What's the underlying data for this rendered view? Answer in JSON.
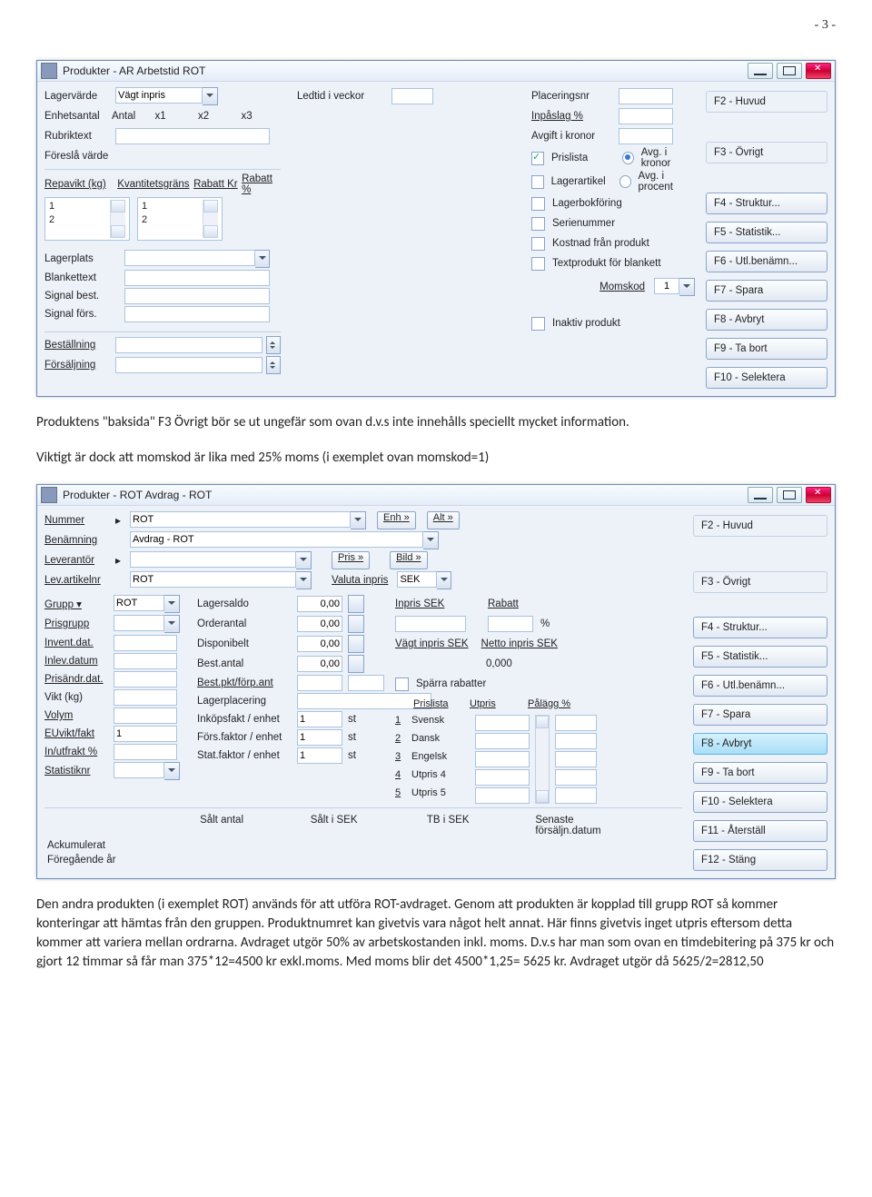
{
  "page_number": "- 3 -",
  "doc": {
    "p1": "Produktens \"baksida\" F3 Övrigt bör se ut ungefär som ovan d.v.s  inte innehålls speciellt mycket information.",
    "p2": "Viktigt är dock att momskod är lika med 25% moms (i exemplet ovan momskod=1)",
    "p3": "Den andra produkten (i exemplet ROT) används för att utföra ROT-avdraget. Genom att produkten är kopplad till grupp ROT så kommer konteringar att hämtas från den gruppen. Produktnumret kan givetvis vara något helt annat. Här finns givetvis inget utpris eftersom detta kommer att variera mellan ordrarna. Avdraget utgör 50% av arbetskostanden inkl. moms. D.v.s har man som ovan en timdebitering på 375 kr och gjort 12 timmar så får man 375*12=4500 kr exkl.moms. Med moms blir det 4500*1,25= 5625 kr. Avdraget utgör då 5625/2=2812,50"
  },
  "win1": {
    "title": "Produkter - AR Arbetstid ROT",
    "labels": {
      "lagervarde": "Lagervärde",
      "enhetsantal": "Enhetsantal",
      "rubriktext": "Rubriktext",
      "foresla": "Föreslå värde",
      "repavikt": "Repavikt (kg)",
      "kvant": "Kvantitetsgräns",
      "rabattkr": "Rabatt Kr",
      "rabattp": "Rabatt %",
      "lagerplats": "Lagerplats",
      "blankettext": "Blankettext",
      "signalbest": "Signal best.",
      "signalfors": "Signal förs.",
      "bestallning": "Beställning",
      "forsaljning": "Försäljning",
      "ledtid": "Ledtid i veckor",
      "antal": "Antal",
      "x1": "x1",
      "x2": "x2",
      "x3": "x3",
      "placering": "Placeringsnr",
      "inpaslag": "Inpåslag %",
      "avgift": "Avgift i kronor",
      "prislista": "Prislista",
      "lagerartikel": "Lagerartikel",
      "lagerbok": "Lagerbokföring",
      "serienr": "Serienummer",
      "kostnad": "Kostnad från produkt",
      "textprodukt": "Textprodukt för blankett",
      "avgkr": "Avg. i kronor",
      "avgp": "Avg. i procent",
      "momskod": "Momskod",
      "momskod_val": "1",
      "inaktiv": "Inaktiv produkt",
      "vagt": "Vägt inpris"
    },
    "side": [
      "F2 - Huvud",
      "F3 - Övrigt",
      "F4 - Struktur...",
      "F5 - Statistik...",
      "F6 - Utl.benämn...",
      "F7 - Spara",
      "F8 - Avbryt",
      "F9 - Ta bort",
      "F10 - Selektera"
    ],
    "list": {
      "r1": "1",
      "r2": "2",
      "k1": "1",
      "k2": "2"
    }
  },
  "win2": {
    "title": "Produkter - ROT Avdrag - ROT",
    "labelsL": {
      "nummer": "Nummer",
      "benamning": "Benämning",
      "leverantor": "Leverantör",
      "levart": "Lev.artikelnr",
      "grupp": "Grupp",
      "prisgrupp": "Prisgrupp",
      "invent": "Invent.dat.",
      "inlev": "Inlev.datum",
      "prisandr": "Prisändr.dat.",
      "vikt": "Vikt (kg)",
      "volym": "Volym",
      "euvikt": "EUvikt/fakt",
      "euvikt_val": "1",
      "inut": "In/utfrakt %",
      "stat": "Statistiknr",
      "ack": "Ackumulerat",
      "foreg": "Föregående år"
    },
    "valsL": {
      "nummer": "ROT",
      "benamning": "Avdrag - ROT",
      "levart": "ROT",
      "grupp": "ROT"
    },
    "labelsM": {
      "lagersaldo": "Lagersaldo",
      "orderantal": "Orderantal",
      "disponibelt": "Disponibelt",
      "bestantal": "Best.antal",
      "bestpkt": "Best.pkt/förp.ant",
      "lagerpl": "Lagerplacering",
      "inkop": "Inköpsfakt / enhet",
      "fors": "Förs.faktor / enhet",
      "statf": "Stat.faktor / enhet",
      "zero": "0,00",
      "one": "1",
      "st": "st"
    },
    "labelsR": {
      "enh": "Enh »",
      "alt": "Alt »",
      "pris": "Pris  »",
      "bild": "Bild »",
      "valuta": "Valuta inpris",
      "valuta_val": "SEK",
      "inpris": "Inpris SEK",
      "rabatt": "Rabatt",
      "pct": "%",
      "vagt": "Vägt inpris SEK",
      "netto": "Netto inpris SEK",
      "nettov": "0,000",
      "sparra": "Spärra rabatter",
      "prislista": "Prislista",
      "utpris": "Utpris",
      "palagg": "Pålägg %",
      "p1": "Svensk",
      "p2": "Dansk",
      "p3": "Engelsk",
      "p4": "Utpris 4",
      "p5": "Utpris 5",
      "n1": "1",
      "n2": "2",
      "n3": "3",
      "n4": "4",
      "n5": "5"
    },
    "bottom": {
      "salt": "Sålt antal",
      "saltsek": "Sålt i SEK",
      "tb": "TB i SEK",
      "senaste": "Senaste",
      "forsd": "försäljn.datum"
    },
    "side": [
      "F2 - Huvud",
      "F3 - Övrigt",
      "F4 - Struktur...",
      "F5 - Statistik...",
      "F6 - Utl.benämn...",
      "F7 - Spara",
      "F8 - Avbryt",
      "F9 - Ta bort",
      "F10 - Selektera",
      "F11 - Återställ",
      "F12 - Stäng"
    ]
  }
}
